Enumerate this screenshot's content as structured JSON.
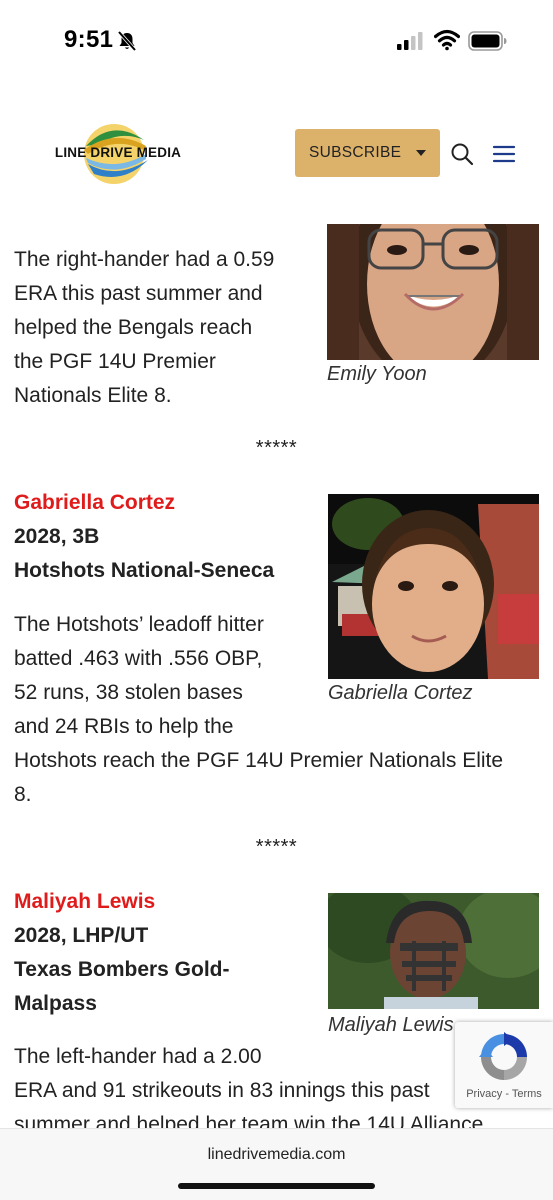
{
  "status_bar": {
    "time": "9:51"
  },
  "header": {
    "logo_text": "LINE DRIVE MEDIA",
    "subscribe_label": "SUBSCRIBE"
  },
  "article": {
    "intro_paragraph": [
      "The right-hander had a 0.59",
      "ERA this past summer and",
      "helped the Bengals reach",
      "the PGF 14U Premier",
      "Nationals Elite 8."
    ],
    "photo_1_caption": "Emily Yoon",
    "separator": "*****",
    "player_2": {
      "name": "Gabriella Cortez",
      "class_position": "2028, 3B",
      "team": "Hotshots National-Seneca",
      "photo_caption": "Gabriella Cortez",
      "paragraph": [
        "The Hotshots’ leadoff hitter",
        "batted .463 with .556 OBP,",
        "52 runs, 38 stolen bases",
        "and 24 RBIs to help the",
        "Hotshots reach the PGF 14U Premier Nationals Elite",
        "8."
      ]
    },
    "player_3": {
      "name": "Maliyah Lewis",
      "class_position": "2028, LHP/UT",
      "team_lines": [
        "Texas Bombers Gold-",
        "Malpass"
      ],
      "photo_caption": "Maliyah Lewis",
      "paragraph": [
        "The left-hander had a 2.00",
        "ERA and 91 strikeouts in 83 innings this past",
        "summer and helped her team win the 14U Alliance"
      ]
    }
  },
  "recaptcha": {
    "links": "Privacy - Terms"
  },
  "browser": {
    "url": "linedrivemedia.com"
  },
  "colors": {
    "accent_red": "#e01b1b",
    "subscribe_gold": "#dcb26b"
  }
}
